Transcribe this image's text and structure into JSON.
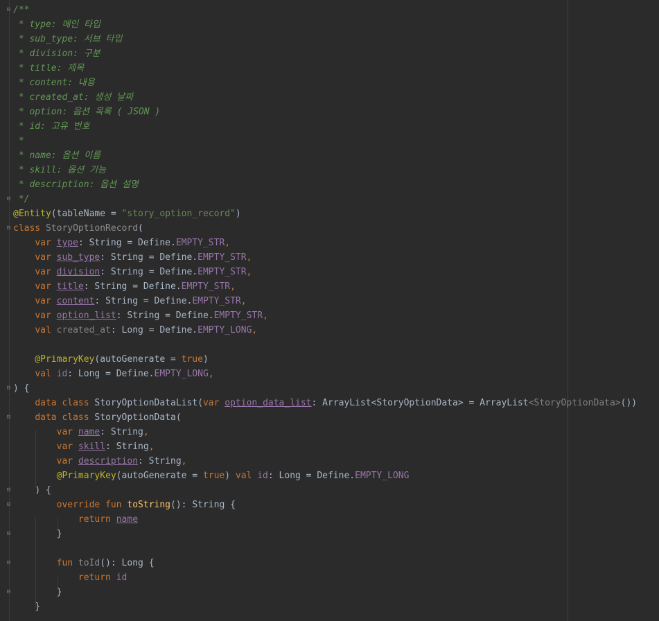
{
  "editor": {
    "lines": [
      "/**",
      " * type: 메인 타입",
      " * sub_type: 서브 타입",
      " * division: 구분",
      " * title: 제목",
      " * content: 내용",
      " * created_at: 생성 날짜",
      " * option: 옵션 목록 ( JSON )",
      " * id: 고유 번호",
      " *",
      " * name: 옵션 이름",
      " * skill: 옵션 기능",
      " * description: 옵션 설명",
      " */"
    ],
    "entity": {
      "annotation": "@Entity",
      "open": "(tableName = ",
      "table_name": "\"story_option_record\"",
      "close": ")"
    },
    "class_line": {
      "kw": "class",
      "name": "StoryOptionRecord",
      "paren": "("
    },
    "fields": [
      {
        "kw": "var",
        "name": "type",
        "rest": ": String = Define.",
        "const": "EMPTY_STR",
        "end": ","
      },
      {
        "kw": "var",
        "name": "sub_type",
        "rest": ": String = Define.",
        "const": "EMPTY_STR",
        "end": ","
      },
      {
        "kw": "var",
        "name": "division",
        "rest": ": String = Define.",
        "const": "EMPTY_STR",
        "end": ","
      },
      {
        "kw": "var",
        "name": "title",
        "rest": ": String = Define.",
        "const": "EMPTY_STR",
        "end": ","
      },
      {
        "kw": "var",
        "name": "content",
        "rest": ": String = Define.",
        "const": "EMPTY_STR",
        "end": ","
      },
      {
        "kw": "var",
        "name": "option_list",
        "rest": ": String = Define.",
        "const": "EMPTY_STR",
        "end": ","
      },
      {
        "kw": "val",
        "name": "created_at",
        "rest": ": Long = Define.",
        "const": "EMPTY_LONG",
        "end": ","
      }
    ],
    "pk1": {
      "ann": "@PrimaryKey",
      "open": "(autoGenerate = ",
      "val": "true",
      "close": ")"
    },
    "id_field": {
      "kw": "val",
      "name": "id",
      "rest": ": Long = Define.",
      "const": "EMPTY_LONG",
      "end": ","
    },
    "close_brace": ") {",
    "datalist": {
      "kw1": "data",
      "kw2": "class",
      "name": "StoryOptionDataList(",
      "kw3": "var",
      "prop": "option_data_list",
      "rest": ": ArrayList<StoryOptionData> = ArrayList",
      "generic": "<StoryOptionData>",
      "end": "())"
    },
    "dataclass": {
      "kw1": "data",
      "kw2": "class",
      "name": "StoryOptionData("
    },
    "inner_fields": [
      {
        "kw": "var",
        "name": "name",
        "rest": ": String",
        "end": ","
      },
      {
        "kw": "var",
        "name": "skill",
        "rest": ": String",
        "end": ","
      },
      {
        "kw": "var",
        "name": "description",
        "rest": ": String",
        "end": ","
      }
    ],
    "pk2": {
      "ann": "@PrimaryKey",
      "open": "(autoGenerate = ",
      "val": "true",
      "mid": ") ",
      "kw": "val",
      "name": "id",
      "rest": ": Long = Define.",
      "const": "EMPTY_LONG"
    },
    "inner_close": ") {",
    "tostring": {
      "kw1": "override",
      "kw2": "fun",
      "name": "toString",
      "rest": "(): String {"
    },
    "return1": {
      "kw": "return",
      "name": "name"
    },
    "brace": "}",
    "toid": {
      "kw": "fun",
      "name": "toId",
      "rest": "(): Long {"
    },
    "return2": {
      "kw": "return",
      "name": "id"
    }
  }
}
